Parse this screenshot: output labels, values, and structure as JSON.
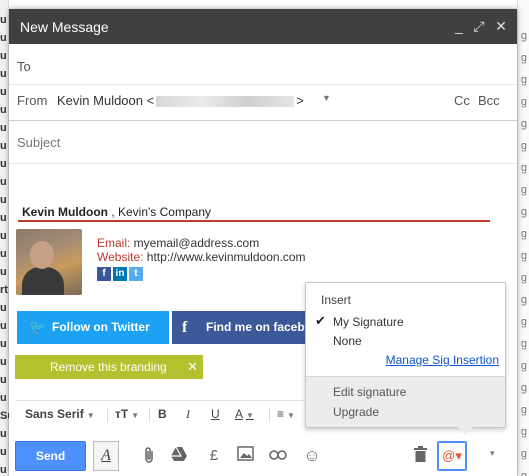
{
  "background": {
    "left_letters": [
      "u",
      "u",
      "u",
      "u",
      "u",
      "u",
      "u",
      "u",
      "u",
      "u",
      "u",
      "u",
      "u",
      "u",
      "u",
      "rt",
      "u",
      "u",
      "u",
      "u",
      "u",
      "u",
      "Su",
      "u",
      "u",
      "u"
    ],
    "right_letters": [
      "g",
      "g",
      "g",
      "g",
      "g",
      "g",
      "g",
      "g",
      "g",
      "g",
      "g",
      "g",
      "g",
      "g",
      "g",
      "g",
      "g",
      "g",
      "g",
      "g",
      "g"
    ]
  },
  "window": {
    "title": "New Message",
    "controls": {
      "minimize": "_",
      "popout": "⤢",
      "close": "✕"
    }
  },
  "compose": {
    "to_label": "To",
    "from_label": "From",
    "from_name": "Kevin Muldoon <",
    "from_tail": ">",
    "cc_label": "Cc",
    "bcc_label": "Bcc",
    "subject_placeholder": "Subject"
  },
  "signature": {
    "name": "Kevin Muldoon",
    "company": " , Kevin's Company",
    "email_label": "Email:",
    "email_value": " myemail@address.com",
    "website_label": "Website:",
    "website_value": " http://www.kevinmuldoon.com",
    "social_icons": [
      "f",
      "in",
      "t"
    ],
    "twitter_button": "Follow on Twitter",
    "facebook_button": "Find me on facebook",
    "branding_button": "Remove this branding",
    "branding_close": "✕"
  },
  "formatting": {
    "font": "Sans Serif",
    "size_icon": "тT",
    "bold": "B",
    "italic": "I",
    "underline": "U",
    "text_color": "A",
    "align": "≡"
  },
  "bottombar": {
    "send_label": "Send",
    "format_icon_glyph": "A",
    "currency_glyph": "£",
    "emoji_glyph": "☺",
    "sig_glyph": "@▾",
    "more_glyph": "▾"
  },
  "signature_menu": {
    "insert_header": "Insert",
    "items": [
      "My Signature",
      "None"
    ],
    "checked_item": "My Signature",
    "manage_link": "Manage Sig Insertion",
    "edit_signature": "Edit signature",
    "upgrade": "Upgrade"
  },
  "colors": {
    "send_button": "#4d90fe",
    "twitter_button": "#1da1f2",
    "facebook_button": "#3b5998",
    "branding_button": "#b3c12f",
    "signature_accent": "#c0392b",
    "titlebar": "#404040"
  }
}
